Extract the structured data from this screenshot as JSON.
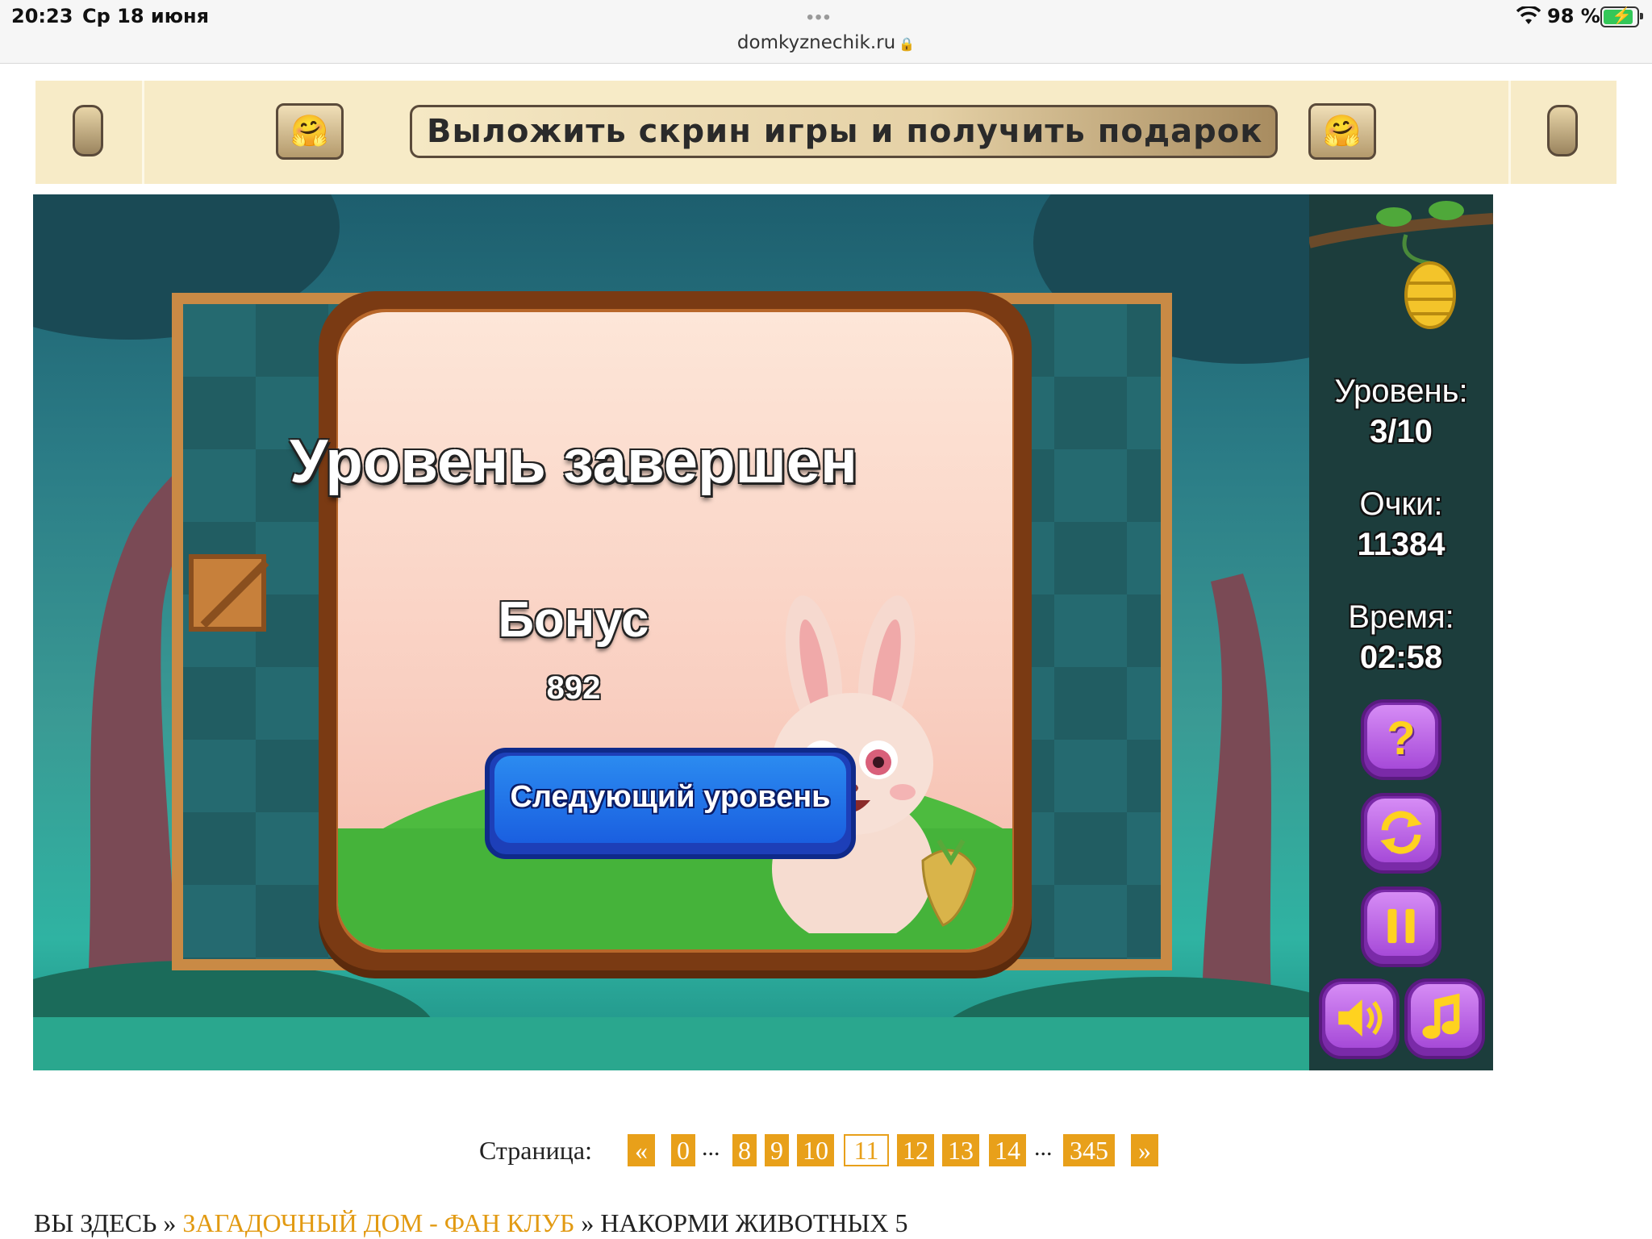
{
  "status_bar": {
    "time": "20:23",
    "date": "Ср 18 июня",
    "url": "domkyznechik.ru",
    "battery": "98 %"
  },
  "banner": {
    "text": "Выложить скрин игры и получить подарок",
    "emoji": "🤗"
  },
  "game": {
    "dialog_title": "Уровень завершен",
    "bonus_label": "Бонус",
    "bonus_value": "892",
    "next_button": "Следующий уровень",
    "hud": {
      "level_label": "Уровень:",
      "level_value": "3/10",
      "score_label": "Очки:",
      "score_value": "11384",
      "time_label": "Время:",
      "time_value": "02:58"
    },
    "buttons": {
      "help": "?",
      "restart_icon": "restart-icon",
      "pause_icon": "pause-icon",
      "sound_icon": "speaker-icon",
      "music_icon": "music-note-icon"
    }
  },
  "pagination": {
    "label": "Страница:",
    "prev": "«",
    "next": "»",
    "ellipsis": "...",
    "pages": [
      "0",
      "8",
      "9",
      "10",
      "11",
      "12",
      "13",
      "14",
      "345"
    ],
    "current": "11"
  },
  "breadcrumbs": {
    "here": "ВЫ ЗДЕСЬ",
    "sep": "»",
    "link": "ЗАГАДОЧНЫЙ ДОМ - ФАН КЛУБ",
    "current": "НАКОРМИ ЖИВОТНЫХ 5"
  },
  "colors": {
    "accent": "#e8a01a",
    "banner_bg": "#f7ebc7",
    "button_purple": "#b05ae0",
    "button_blue": "#1a5fe0"
  }
}
